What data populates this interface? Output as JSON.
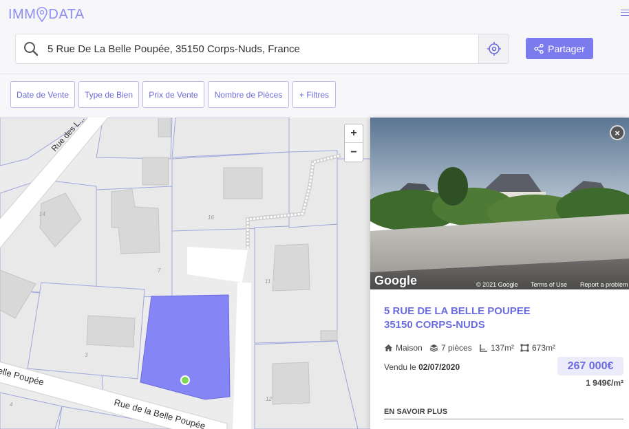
{
  "brand": {
    "part1": "IMM",
    "part2": "DATA"
  },
  "search": {
    "value": "5 Rue De La Belle Poupée, 35150 Corps-Nuds, France"
  },
  "header": {
    "share_label": "Partager"
  },
  "filters": [
    {
      "label": "Date de Vente"
    },
    {
      "label": "Type de Bien"
    },
    {
      "label": "Prix de Vente"
    },
    {
      "label": "Nombre de Pièces"
    },
    {
      "label": "+ Filtres"
    }
  ],
  "map": {
    "zoom_in": "+",
    "zoom_out": "−",
    "street_labels": [
      "Rue des L...",
      "Rue de la Belle Poupée",
      "elle Poupée"
    ],
    "parcel_numbers": [
      "14",
      "16",
      "7",
      "3",
      "4",
      "11",
      "12"
    ]
  },
  "panel": {
    "close": "×",
    "google_logo": "Google",
    "copyright": "© 2021 Google",
    "terms": "Terms of Use",
    "report": "Report a problem",
    "address_line1": "5 RUE DE LA BELLE POUPEE",
    "address_line2": "35150 CORPS-NUDS",
    "features": {
      "type": "Maison",
      "rooms": "7 pièces",
      "living_area": "137m²",
      "land_area": "673m²"
    },
    "sold_prefix": "Vendu le",
    "sold_date": "02/07/2020",
    "price": "267 000€",
    "price_per_m2": "1 949€/m²",
    "more_label": "EN SAVOIR PLUS"
  },
  "colors": {
    "accent": "#7b7bed",
    "parcel": "#8585f5",
    "marker": "#7ed957"
  }
}
